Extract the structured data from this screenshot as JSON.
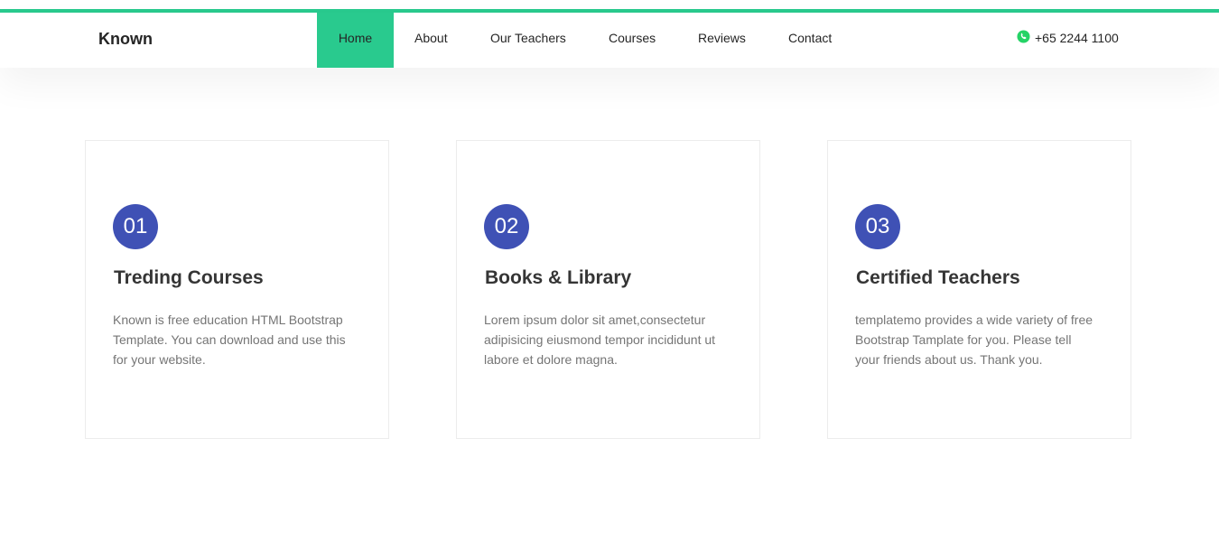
{
  "brand": "Known",
  "nav": {
    "items": [
      {
        "label": "Home"
      },
      {
        "label": "About"
      },
      {
        "label": "Our Teachers"
      },
      {
        "label": "Courses"
      },
      {
        "label": "Reviews"
      },
      {
        "label": "Contact"
      }
    ],
    "active_item": "Home",
    "phone_icon": "whatsapp-phone-icon",
    "phone": "+65 2244 1100"
  },
  "features": [
    {
      "number": "01",
      "title": "Treding Courses",
      "text": "Known is free education HTML Bootstrap Template. You can download and use this for your website."
    },
    {
      "number": "02",
      "title": "Books & Library",
      "text": "Lorem ipsum dolor sit amet,consectetur adipisicing eiusmond tempor incididunt ut labore et dolore magna."
    },
    {
      "number": "03",
      "title": "Certified Teachers",
      "text": "templatemo provides a wide variety of free Bootstrap Tamplate for you. Please tell your friends about us. Thank you."
    }
  ],
  "colors": {
    "accent": "#29ca8e",
    "badge": "#3f51b5",
    "phone_icon": "#25d366"
  }
}
